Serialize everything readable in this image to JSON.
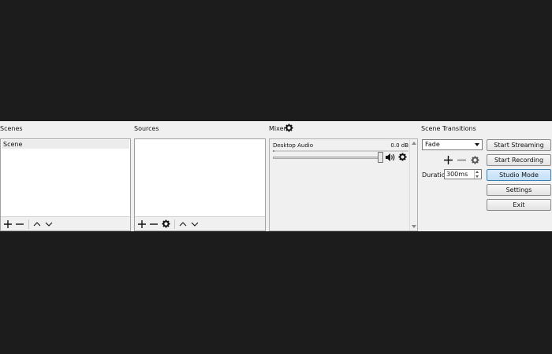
{
  "scenes": {
    "title": "Scenes",
    "items": [
      {
        "label": "Scene",
        "selected": true
      }
    ],
    "toolbar": {
      "add": "+",
      "remove": "−"
    }
  },
  "sources": {
    "title": "Sources",
    "items": [],
    "toolbar": {
      "add": "+",
      "remove": "−"
    }
  },
  "mixer": {
    "title": "Mixer",
    "channels": [
      {
        "name": "Desktop Audio",
        "level": "0.0 dB",
        "volume_fraction": 1.0
      }
    ]
  },
  "transitions": {
    "title": "Scene Transitions",
    "selected": "Fade",
    "duration_label": "Duration",
    "duration_value": "300ms",
    "toolbar": {
      "add": "+",
      "remove": "−"
    }
  },
  "controls": {
    "start_streaming": "Start Streaming",
    "start_recording": "Start Recording",
    "studio_mode": "Studio Mode",
    "settings": "Settings",
    "exit": "Exit"
  },
  "colors": {
    "background": "#1c1c1c",
    "panel": "#f0f0f0",
    "active_button": "#c2e0f8"
  },
  "icons": [
    "plus-icon",
    "minus-icon",
    "gear-icon",
    "chevron-up-icon",
    "chevron-down-icon",
    "speaker-icon"
  ]
}
